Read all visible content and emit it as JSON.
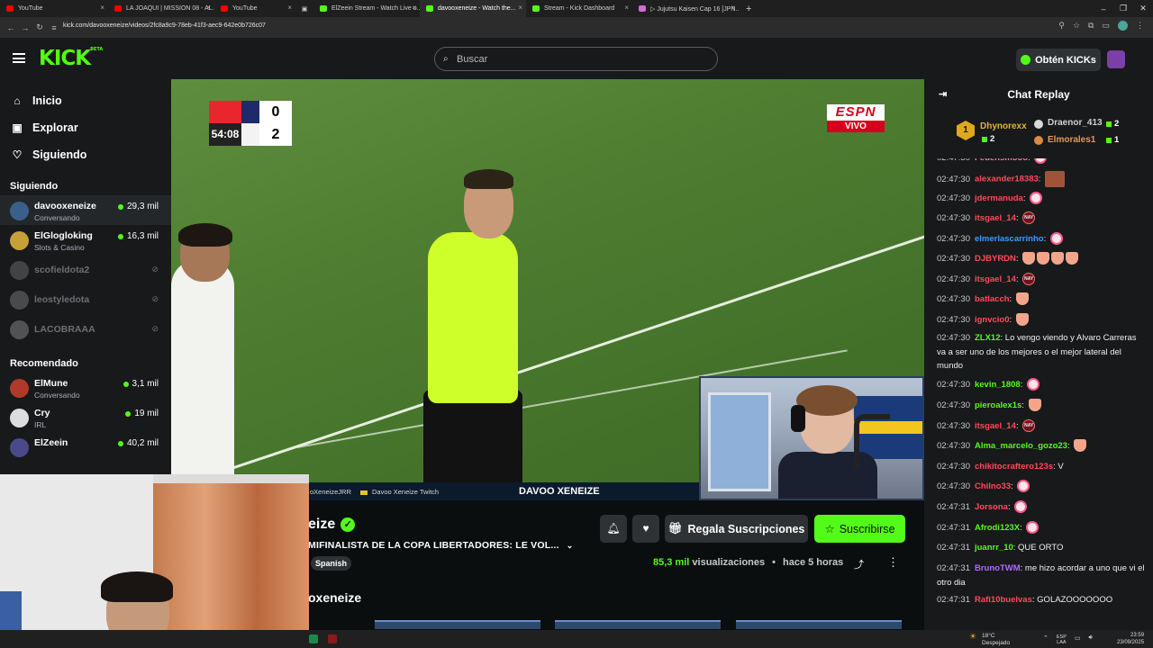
{
  "browser": {
    "tabs": [
      {
        "title": "YouTube",
        "color": "#ff0000"
      },
      {
        "title": "LA JOAQUI | MISSION 08 - AL...",
        "color": "#ff0000"
      },
      {
        "title": "YouTube",
        "color": "#ff0000"
      },
      {
        "title": "ElZeein Stream - Watch Live o...",
        "color": "#53fc18"
      },
      {
        "title": "davooxeneize - Watch the...",
        "color": "#53fc18"
      },
      {
        "title": "Stream - Kick Dashboard",
        "color": "#53fc18"
      },
      {
        "title": "▷ Jujutsu Kaisen Cap 16 [JPN...",
        "color": "#d06bd6"
      }
    ],
    "url": "kick.com/davooxeneize/videos/2fc8a9c9-78eb-41f3-aec9-642e0b726c07"
  },
  "header": {
    "logo": "KICK",
    "logo_badge": "BETA",
    "search_placeholder": "Buscar",
    "kicks_label": "Obtén KICKs"
  },
  "sidebar": {
    "nav": [
      {
        "label": "Inicio",
        "icon": "home-icon"
      },
      {
        "label": "Explorar",
        "icon": "compass-icon"
      },
      {
        "label": "Siguiendo",
        "icon": "heart-icon"
      }
    ],
    "following_title": "Siguiendo",
    "following": [
      {
        "name": "davooxeneize",
        "category": "Conversando",
        "viewers": "29,3 mil",
        "online": true
      },
      {
        "name": "ElGlogloking",
        "category": "Slots & Casino",
        "viewers": "16,3 mil",
        "online": true
      },
      {
        "name": "scofieldota2",
        "online": false
      },
      {
        "name": "leostyledota",
        "online": false
      },
      {
        "name": "LACOBRAAA",
        "online": false
      }
    ],
    "recommended_title": "Recomendado",
    "recommended": [
      {
        "name": "ElMune",
        "category": "Conversando",
        "viewers": "3,1 mil"
      },
      {
        "name": "Cry",
        "category": "IRL",
        "viewers": "19 mil"
      },
      {
        "name": "ElZeein",
        "category": "",
        "viewers": "40,2 mil"
      }
    ]
  },
  "video": {
    "score_home": "0",
    "score_away": "2",
    "match_time": "54:08",
    "broadcaster_top": "ESPN",
    "broadcaster_live": "VIVO",
    "ticker_1": "oXeneizeJRR",
    "ticker_2": "Davoo Xeneize Twitch",
    "ticker_3": "DAVOO XENEIZE"
  },
  "info": {
    "channel_name": "eize",
    "stream_title": "MIFINALISTA DE LA COPA LIBERTADORES: LE VOL...",
    "language": "Spanish",
    "gift_label": "Regala Suscripciones",
    "subscribe_label": "Suscribirse",
    "views": "85,3 mil",
    "views_suffix": "visualizaciones",
    "ago": "hace 5 horas",
    "section_title": "oxeneize"
  },
  "chat": {
    "title": "Chat Replay",
    "leaderboard": [
      {
        "rank": "1",
        "name": "Dhynorexx",
        "count": "2"
      },
      {
        "name": "Draenor_413",
        "count": "2"
      },
      {
        "name": "Elmorales1",
        "count": "1"
      }
    ],
    "messages": [
      {
        "time": "02:47:30",
        "user": "Fedensmooo",
        "color": "#ff7aa8",
        "text": ""
      },
      {
        "time": "02:47:30",
        "user": "alexander18383",
        "color": "#ff4a5a",
        "text": ""
      },
      {
        "time": "02:47:30",
        "user": "jdermanuda",
        "color": "#ff4a5a",
        "text": ""
      },
      {
        "time": "02:47:30",
        "user": "itsgael_14",
        "color": "#ff4a5a",
        "text": ""
      },
      {
        "time": "02:47:30",
        "user": "elmerlascarrinho",
        "color": "#3c9bff",
        "text": ""
      },
      {
        "time": "02:47:30",
        "user": "DJBYRDN",
        "color": "#ff4a5a",
        "text": ""
      },
      {
        "time": "02:47:30",
        "user": "itsgael_14",
        "color": "#ff4a5a",
        "text": ""
      },
      {
        "time": "02:47:30",
        "user": "batlacch",
        "color": "#ff4a5a",
        "text": ""
      },
      {
        "time": "02:47:30",
        "user": "ignvcio0",
        "color": "#ff4a5a",
        "text": ""
      },
      {
        "time": "02:47:30",
        "user": "ZLX12",
        "color": "#53fc18",
        "text": "Lo vengo viendo y Alvaro Carreras va a ser uno de los mejores o el mejor lateral del mundo"
      },
      {
        "time": "02:47:30",
        "user": "kevin_1808",
        "color": "#53fc18",
        "text": ""
      },
      {
        "time": "02:47:30",
        "user": "pieroalex1s",
        "color": "#53fc18",
        "text": ""
      },
      {
        "time": "02:47:30",
        "user": "itsgael_14",
        "color": "#ff4a5a",
        "text": ""
      },
      {
        "time": "02:47:30",
        "user": "Alma_marcelo_gozo23",
        "color": "#53fc18",
        "text": ""
      },
      {
        "time": "02:47:30",
        "user": "chikitocraftero123s",
        "color": "#ff4a5a",
        "text": "V"
      },
      {
        "time": "02:47:30",
        "user": "Chilno33",
        "color": "#ff4a5a",
        "text": ""
      },
      {
        "time": "02:47:31",
        "user": "Jorsona",
        "color": "#ff4a5a",
        "text": ""
      },
      {
        "time": "02:47:31",
        "user": "Afrodi123X",
        "color": "#53fc18",
        "text": ""
      },
      {
        "time": "02:47:31",
        "user": "juanrr_10",
        "color": "#53fc18",
        "text": "QUE ORTO"
      },
      {
        "time": "02:47:31",
        "user": "BrunoTWM",
        "color": "#b26bff",
        "text": "me hizo acordar a uno que vi el otro dia"
      },
      {
        "time": "02:47:31",
        "user": "Rafi10buelvas",
        "color": "#ff4a5a",
        "text": "GOLAZOOOOOOO"
      }
    ]
  },
  "taskbar": {
    "temp": "18°C",
    "weather": "Despejado",
    "lang": "ESP",
    "lang_sub": "LAA",
    "time": "23:59",
    "date": "23/09/2025"
  }
}
